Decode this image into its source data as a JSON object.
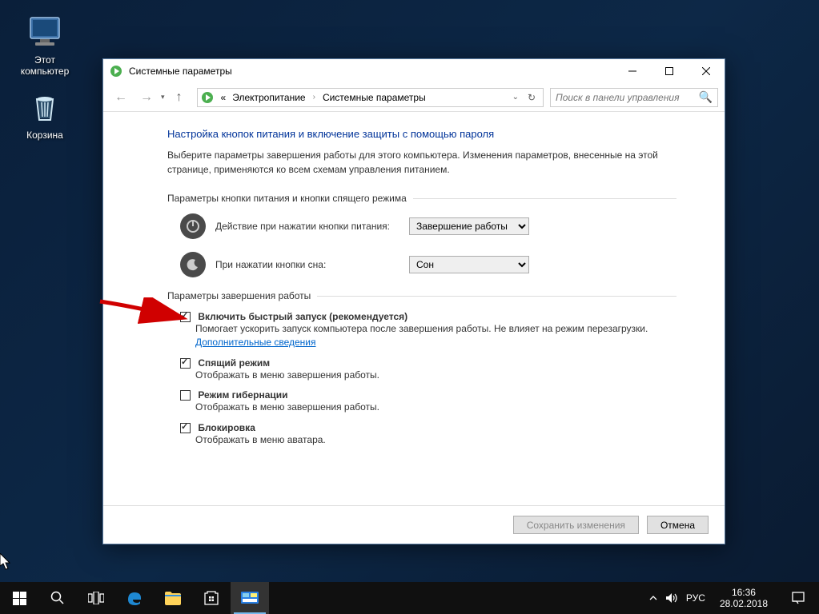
{
  "desktop": {
    "this_pc": "Этот компьютер",
    "recycle_bin": "Корзина"
  },
  "window": {
    "title": "Системные параметры",
    "breadcrumb": {
      "parent": "Электропитание",
      "current": "Системные параметры",
      "prefix": "«"
    },
    "search_placeholder": "Поиск в панели управления",
    "heading": "Настройка кнопок питания и включение защиты с помощью пароля",
    "subtitle": "Выберите параметры завершения работы для этого компьютера. Изменения параметров, внесенные на этой странице, применяются ко всем схемам управления питанием.",
    "section_buttons": "Параметры кнопки питания и кнопки спящего режима",
    "power_button_label": "Действие при нажатии кнопки питания:",
    "power_button_value": "Завершение работы",
    "sleep_button_label": "При нажатии кнопки сна:",
    "sleep_button_value": "Сон",
    "section_shutdown": "Параметры завершения работы",
    "opts": {
      "fast": {
        "label": "Включить быстрый запуск (рекомендуется)",
        "desc_pre": "Помогает ускорить запуск компьютера после завершения работы. Не влияет на режим перезагрузки. ",
        "link": "Дополнительные сведения"
      },
      "sleep": {
        "label": "Спящий режим",
        "desc": "Отображать в меню завершения работы."
      },
      "hibernate": {
        "label": "Режим гибернации",
        "desc": "Отображать в меню завершения работы."
      },
      "lock": {
        "label": "Блокировка",
        "desc": "Отображать в меню аватара."
      }
    },
    "save_button": "Сохранить изменения",
    "cancel_button": "Отмена"
  },
  "taskbar": {
    "lang": "РУС",
    "time": "16:36",
    "date": "28.02.2018"
  }
}
